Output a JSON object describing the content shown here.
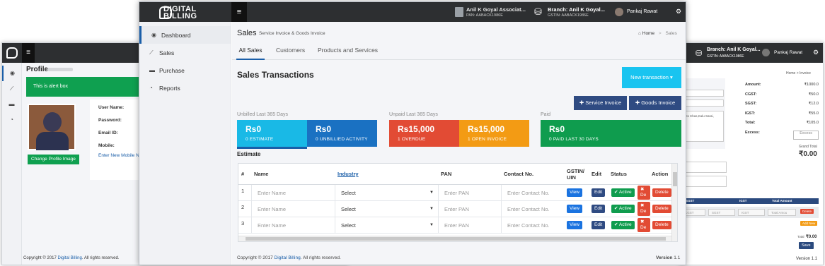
{
  "left_window": {
    "profile_title": "Profile",
    "alert_text": "This is alert box",
    "fields": [
      "User Name:",
      "Password:",
      "Email ID:",
      "Mobile:"
    ],
    "enter_mobile": "Enter New Mobile N",
    "change_image_btn": "Change Profile Image",
    "footer_prefix": "Copyright © 2017 ",
    "footer_link": "Digital Billing",
    "footer_suffix": ". All rights reserved."
  },
  "right_window": {
    "branch": "Branch: Anil K Goyal...",
    "gstin": "GSTIN: AABACK1986E",
    "user": "Pankaj Rawat",
    "breadcrumb": "Home  >  Invoice",
    "summary": [
      {
        "label": "Amount:",
        "value": "₹1000.0"
      },
      {
        "label": "CGST:",
        "value": "₹50.0"
      },
      {
        "label": "SGST:",
        "value": "₹12.0"
      },
      {
        "label": "IGST:",
        "value": "₹55.0"
      },
      {
        "label": "Total:",
        "value": "₹105.0"
      },
      {
        "label": "Excess:",
        "value": "Excess"
      }
    ],
    "address": "Dev Khas,Kalu Sarai,",
    "grand_total_label": "Grand Total",
    "grand_total": "₹0.00",
    "table_headers": [
      "SGST",
      "IGST",
      "Total Amount"
    ],
    "row_inputs": [
      "CGST",
      "SGST",
      "IGST",
      "Total Amou"
    ],
    "delete_btn": "Delete",
    "add_new_btn": "Add New",
    "total_label": "Total",
    "total_value": "₹0.00",
    "save_btn": "Save",
    "version": "Version 1.1"
  },
  "main": {
    "logo_line1": "DIGITAL",
    "logo_line2": "BILLING",
    "header_company": "Anil K Goyal Associat...",
    "header_pan": "PAN: AABACK1986E",
    "header_branch": "Branch: Anil K Goyal...",
    "header_gstin": "GSTIN: AABACK1986E",
    "header_user": "Pankaj Rawat",
    "sidebar": [
      {
        "label": "Dashboard",
        "icon": "dashboard-icon"
      },
      {
        "label": "Sales",
        "icon": "chart-icon"
      },
      {
        "label": "Purchase",
        "icon": "cart-icon"
      },
      {
        "label": "Reports",
        "icon": "pie-icon"
      }
    ],
    "page_title": "Sales",
    "page_subtitle": "Service Invoice & Goods Invoice",
    "breadcrumb_home": "Home",
    "breadcrumb_current": "Sales",
    "tabs": [
      "All Sales",
      "Customers",
      "Products and Services"
    ],
    "section_title": "Sales Transactions",
    "new_transaction_btn": "New transaction",
    "service_invoice_btn": "Service Invoice",
    "goods_invoice_btn": "Goods Invoice",
    "group_unbilled": "Unbilled Last 365 Days",
    "group_unpaid": "Unpaid Last 365 Days",
    "group_paid": "Paid",
    "tiles": [
      {
        "amount": "Rs0",
        "label": "0 ESTIMATE",
        "color": "#19b9e6"
      },
      {
        "amount": "Rs0",
        "label": "0 UNBILLIED ACTIVITY",
        "color": "#1a71c2"
      },
      {
        "amount": "Rs15,000",
        "label": "1 OVERDUE",
        "color": "#e24b34"
      },
      {
        "amount": "Rs15,000",
        "label": "1 OPEN INVOICE",
        "color": "#f39b14"
      },
      {
        "amount": "Rs0",
        "label": "0 PAID LAST 30 DAYS",
        "color": "#0f9c4e"
      }
    ],
    "estimate_label": "Estimate",
    "table_headers": {
      "num": "#",
      "name": "Name",
      "industry": "Industry",
      "pan": "PAN",
      "contact": "Contact No.",
      "gstin1": "GSTIN/",
      "gstin2": "UIN",
      "edit": "Edit",
      "status": "Status",
      "action": "Action"
    },
    "rows": [
      {
        "num": "1",
        "name_ph": "Enter Name",
        "industry": "Select",
        "pan_ph": "Enter PAN",
        "contact_ph": "Enter Contact No.",
        "view": "View",
        "edit": "Edit",
        "active": "✔ Active",
        "deact": "✖ De",
        "delete": "Delete"
      },
      {
        "num": "2",
        "name_ph": "Enter Name",
        "industry": "Select",
        "pan_ph": "Enter PAN",
        "contact_ph": "Enter Contact No.",
        "view": "View",
        "edit": "Edit",
        "active": "✔ Active",
        "deact": "✖ De",
        "delete": "Delete"
      },
      {
        "num": "3",
        "name_ph": "Enter Name",
        "industry": "Select",
        "pan_ph": "Enter PAN",
        "contact_ph": "Enter Contact No.",
        "view": "View",
        "edit": "Edit",
        "active": "✔ Active",
        "deact": "✖ De",
        "delete": "Delete"
      }
    ],
    "footer_prefix": "Copyright © 2017 ",
    "footer_link": "Digital Billing",
    "footer_suffix": ". All rights reserved.",
    "version_label": "Version",
    "version_num": "1.1"
  }
}
